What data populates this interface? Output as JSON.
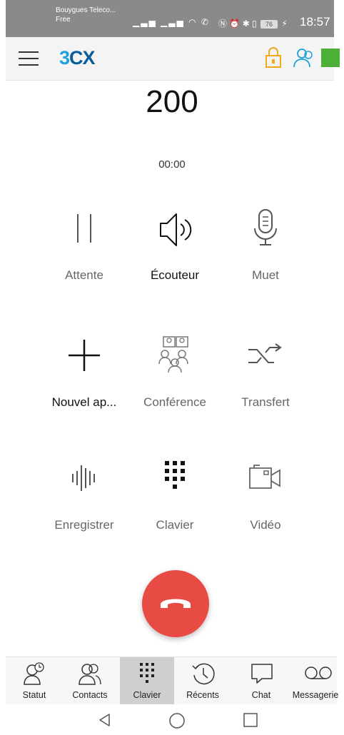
{
  "status_bar": {
    "carrier_line1": "Bouygues Teleco...",
    "carrier_line2": "Free",
    "left_icons": "signal-icon, signal-icon, wifi-icon, call-icon",
    "right_icons": "nfc-icon, alarm-icon, bluetooth-icon, vibrate-icon",
    "battery": "76",
    "time": "18:57"
  },
  "app_bar": {
    "logo_part1": "3",
    "logo_part2": "CX",
    "presence_color": "#4caf38",
    "lock_color": "#f0a81c"
  },
  "call": {
    "number": "200",
    "timer": "00:00"
  },
  "actions": [
    {
      "label": "Attente",
      "icon": "pause-icon"
    },
    {
      "label": "Écouteur",
      "icon": "speaker-icon"
    },
    {
      "label": "Muet",
      "icon": "microphone-icon"
    },
    {
      "label": "Nouvel ap...",
      "icon": "plus-icon"
    },
    {
      "label": "Conférence",
      "icon": "conference-icon"
    },
    {
      "label": "Transfert",
      "icon": "transfer-icon"
    },
    {
      "label": "Enregistrer",
      "icon": "record-icon"
    },
    {
      "label": "Clavier",
      "icon": "dialpad-icon"
    },
    {
      "label": "Vidéo",
      "icon": "video-icon"
    }
  ],
  "end_call": {
    "color": "#e84b44",
    "icon": "hangup-icon"
  },
  "tabs": [
    {
      "label": "Statut",
      "icon": "status-icon"
    },
    {
      "label": "Contacts",
      "icon": "contacts-icon"
    },
    {
      "label": "Clavier",
      "icon": "dialpad-icon",
      "active": true
    },
    {
      "label": "Récents",
      "icon": "history-icon"
    },
    {
      "label": "Chat",
      "icon": "chat-icon"
    },
    {
      "label": "Messagerie",
      "icon": "voicemail-icon"
    }
  ],
  "nav": {
    "back": "back-icon",
    "home": "home-icon",
    "recents": "overview-icon"
  }
}
